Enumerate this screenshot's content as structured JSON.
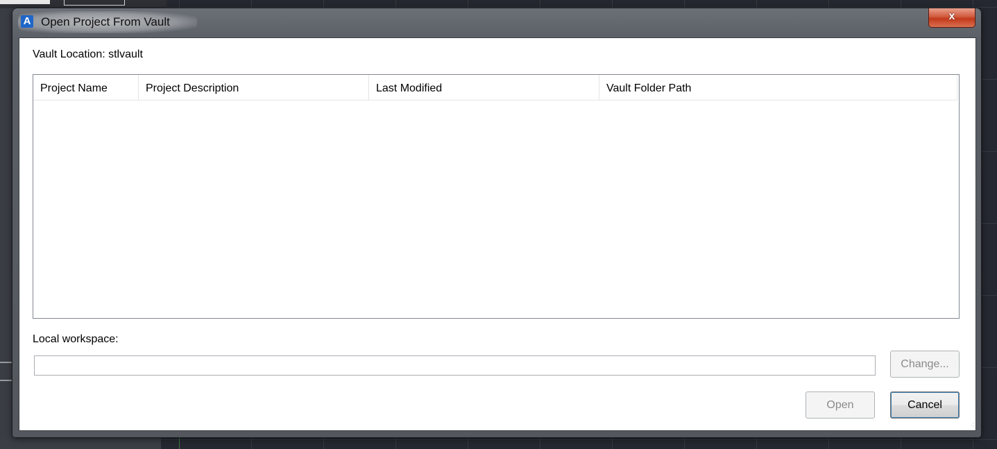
{
  "window": {
    "title": "Open Project From Vault",
    "app_icon_letter": "A",
    "close_glyph": "x"
  },
  "vault_location": "Vault Location: stlvault",
  "table": {
    "columns": [
      "Project Name",
      "Project Description",
      "Last Modified",
      "Vault Folder Path"
    ],
    "rows": []
  },
  "workspace": {
    "label": "Local workspace:",
    "value": "",
    "placeholder": ""
  },
  "buttons": {
    "change": "Change...",
    "open": "Open",
    "cancel": "Cancel"
  },
  "icons": {
    "app": "autodesk-a-icon",
    "close": "close-icon",
    "resize": "resize-grip-icon"
  },
  "colors": {
    "close_button": "#c2391b",
    "app_icon": "#1f66c9",
    "default_button_focus": "#3c7fb1"
  }
}
